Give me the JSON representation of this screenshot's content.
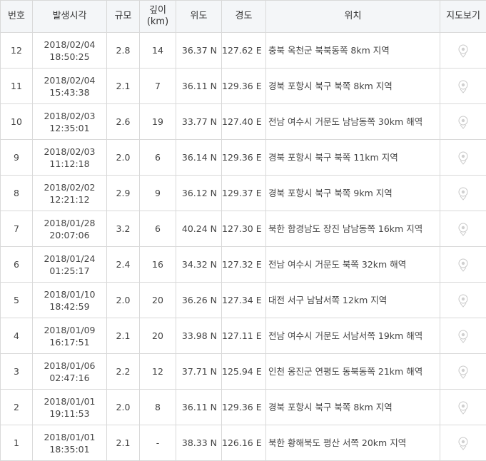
{
  "headers": {
    "no": "번호",
    "time": "발생시각",
    "magnitude": "규모",
    "depth_top": "깊이",
    "depth_unit": "(km)",
    "lat": "위도",
    "lon": "경도",
    "location": "위치",
    "map": "지도보기"
  },
  "map_icon": "map-pin-icon",
  "rows": [
    {
      "no": "12",
      "date": "2018/02/04",
      "time": "18:50:25",
      "mag": "2.8",
      "depth": "14",
      "lat": "36.37 N",
      "lon": "127.62 E",
      "loc": "충북 옥천군 북북동쪽 8km 지역"
    },
    {
      "no": "11",
      "date": "2018/02/04",
      "time": "15:43:38",
      "mag": "2.1",
      "depth": "7",
      "lat": "36.11 N",
      "lon": "129.36 E",
      "loc": "경북 포항시 북구 북쪽 8km 지역"
    },
    {
      "no": "10",
      "date": "2018/02/03",
      "time": "12:35:01",
      "mag": "2.6",
      "depth": "19",
      "lat": "33.77 N",
      "lon": "127.40 E",
      "loc": "전남 여수시 거문도 남남동쪽 30km 해역"
    },
    {
      "no": "9",
      "date": "2018/02/03",
      "time": "11:12:18",
      "mag": "2.0",
      "depth": "6",
      "lat": "36.14 N",
      "lon": "129.36 E",
      "loc": "경북 포항시 북구 북쪽 11km 지역"
    },
    {
      "no": "8",
      "date": "2018/02/02",
      "time": "12:21:12",
      "mag": "2.9",
      "depth": "9",
      "lat": "36.12 N",
      "lon": "129.37 E",
      "loc": "경북 포항시 북구 북쪽 9km 지역"
    },
    {
      "no": "7",
      "date": "2018/01/28",
      "time": "20:07:06",
      "mag": "3.2",
      "depth": "6",
      "lat": "40.24 N",
      "lon": "127.30 E",
      "loc": "북한 함경남도 장진 남남동쪽 16km 지역"
    },
    {
      "no": "6",
      "date": "2018/01/24",
      "time": "01:25:17",
      "mag": "2.4",
      "depth": "16",
      "lat": "34.32 N",
      "lon": "127.32 E",
      "loc": "전남 여수시 거문도 북쪽 32km 해역"
    },
    {
      "no": "5",
      "date": "2018/01/10",
      "time": "18:42:59",
      "mag": "2.0",
      "depth": "20",
      "lat": "36.26 N",
      "lon": "127.34 E",
      "loc": "대전 서구 남남서쪽 12km 지역"
    },
    {
      "no": "4",
      "date": "2018/01/09",
      "time": "16:17:51",
      "mag": "2.1",
      "depth": "20",
      "lat": "33.98 N",
      "lon": "127.11 E",
      "loc": "전남 여수시 거문도 서남서쪽 19km 해역"
    },
    {
      "no": "3",
      "date": "2018/01/06",
      "time": "02:47:16",
      "mag": "2.2",
      "depth": "12",
      "lat": "37.71 N",
      "lon": "125.94 E",
      "loc": "인천 옹진군 연평도 동북동쪽 21km 해역"
    },
    {
      "no": "2",
      "date": "2018/01/01",
      "time": "19:11:53",
      "mag": "2.0",
      "depth": "8",
      "lat": "36.11 N",
      "lon": "129.36 E",
      "loc": "경북 포항시 북구 북쪽 8km 지역"
    },
    {
      "no": "1",
      "date": "2018/01/01",
      "time": "18:35:01",
      "mag": "2.1",
      "depth": "-",
      "lat": "38.33 N",
      "lon": "126.16 E",
      "loc": "북한 황해북도 평산 서쪽 20km 지역"
    }
  ]
}
